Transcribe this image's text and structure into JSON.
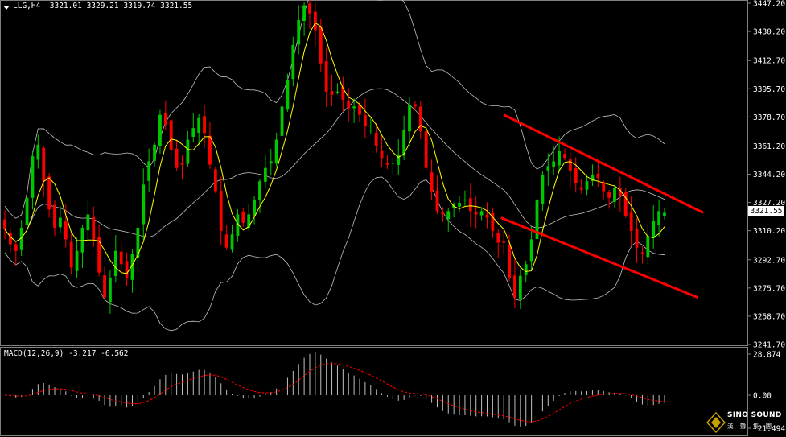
{
  "main_header": {
    "symbol": "LLG,H4",
    "open": "3321.01",
    "high": "3329.21",
    "low": "3319.74",
    "close": "3321.55"
  },
  "macd_header": {
    "name": "MACD(12,26,9)",
    "main": "-3.217",
    "signal": "-6.562"
  },
  "current_price_tag": "3321.55",
  "price_axis_labels": [
    "3447.20",
    "3430.20",
    "3412.70",
    "3395.70",
    "3378.70",
    "3361.20",
    "3344.20",
    "3327.20",
    "3310.20",
    "3292.70",
    "3275.70",
    "3258.70",
    "3241.70"
  ],
  "macd_axis_labels": [
    "28.874",
    "0.00",
    "-21.494"
  ],
  "logo": {
    "line1": "SINO SOUND",
    "line2": "漢 聲 集 團"
  },
  "colors": {
    "background": "#000000",
    "bull_candle": "#00c800",
    "bear_candle": "#ff0000",
    "moving_average": "#ffff00",
    "bollinger_bands": "#c0c0c0",
    "channel_lines": "#ff0000",
    "macd_histogram": "#c0c0c0",
    "macd_signal": "#ff0000",
    "axis_text": "#ffffff"
  },
  "chart_data": {
    "type": "candlestick",
    "timeframe": "H4",
    "ylim": [
      3241.7,
      3447.2
    ],
    "close_series": [
      3311,
      3302,
      3298,
      3312,
      3330,
      3355,
      3362,
      3340,
      3323,
      3312,
      3318,
      3305,
      3288,
      3298,
      3312,
      3320,
      3305,
      3285,
      3270,
      3282,
      3298,
      3290,
      3282,
      3296,
      3312,
      3338,
      3352,
      3362,
      3380,
      3374,
      3359,
      3348,
      3350,
      3365,
      3372,
      3378,
      3369,
      3350,
      3334,
      3310,
      3300,
      3308,
      3320,
      3315,
      3320,
      3329,
      3340,
      3348,
      3352,
      3365,
      3385,
      3401,
      3422,
      3437,
      3446,
      3441,
      3431,
      3411,
      3394,
      3392,
      3394,
      3389,
      3384,
      3385,
      3380,
      3373,
      3371,
      3361,
      3354,
      3350,
      3351,
      3356,
      3371,
      3386,
      3385,
      3370,
      3348,
      3334,
      3322,
      3320,
      3322,
      3326,
      3327,
      3329,
      3322,
      3320,
      3322,
      3318,
      3310,
      3303,
      3303,
      3282,
      3270,
      3283,
      3290,
      3305,
      3329,
      3344,
      3349,
      3352,
      3358,
      3354,
      3346,
      3339,
      3335,
      3340,
      3344,
      3342,
      3334,
      3330,
      3336,
      3331,
      3319,
      3310,
      3300,
      3297,
      3307,
      3316,
      3322,
      3321
    ],
    "channel": {
      "upper": [
        [
          3380.0,
          3321.0
        ]
      ],
      "lower": [
        [
          3318.0,
          3270.0
        ]
      ]
    },
    "macd": {
      "period": "12,26,9",
      "main_last": -3.217,
      "signal_last": -6.562,
      "ylim": [
        -21.494,
        28.874
      ]
    }
  }
}
